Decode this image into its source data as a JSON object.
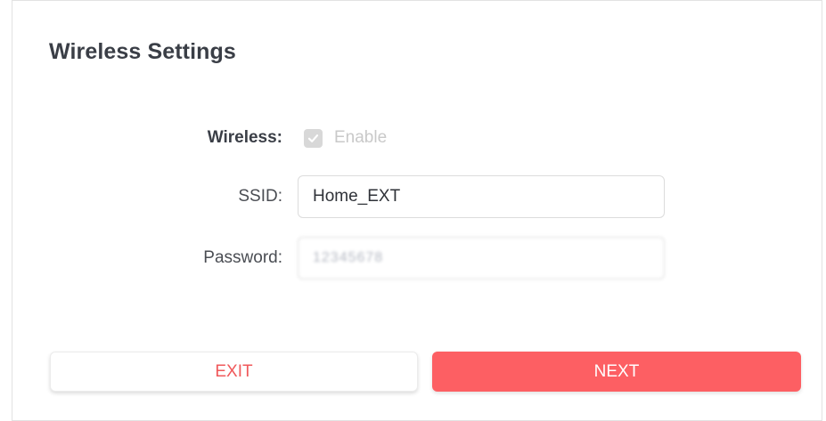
{
  "page": {
    "title": "Wireless Settings"
  },
  "form": {
    "wireless": {
      "label": "Wireless:",
      "checkbox_checked": true,
      "checkbox_disabled": true,
      "checkbox_label": "Enable"
    },
    "ssid": {
      "label": "SSID:",
      "value": "Home_EXT"
    },
    "password": {
      "label": "Password:",
      "value": "12345678"
    }
  },
  "actions": {
    "exit_label": "EXIT",
    "next_label": "NEXT"
  },
  "colors": {
    "accent": "#fd5f63",
    "exit_text": "#f0595b",
    "title_text": "#3a3e46",
    "disabled_checkbox": "#d8d8d8"
  }
}
